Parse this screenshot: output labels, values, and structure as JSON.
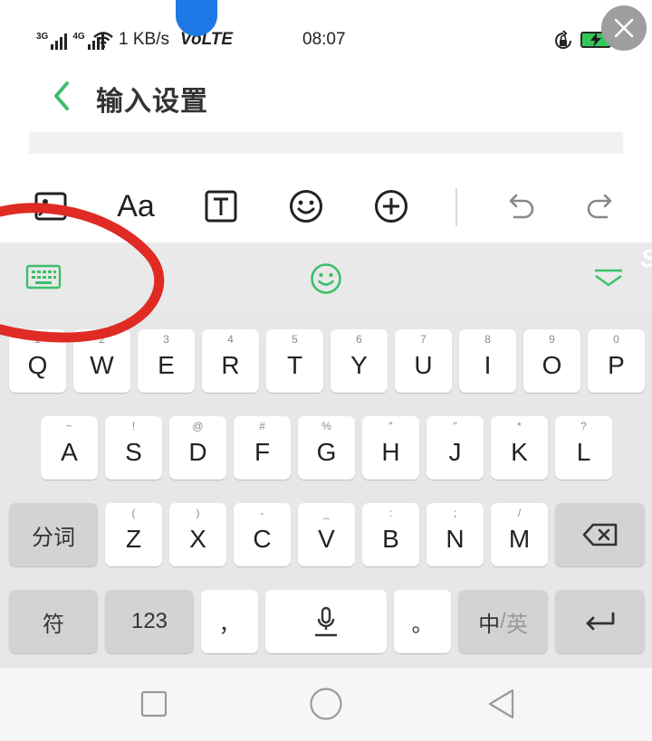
{
  "status_bar": {
    "network_1": "3G",
    "network_2": "4G",
    "speed": "1 KB/s",
    "volte": "VoLTE",
    "time": "08:07"
  },
  "header": {
    "title": "输入设置"
  },
  "colors": {
    "accent": "#3cc06a",
    "annotation_red": "#e02a24",
    "keyboard_bg": "#e7e7e7",
    "func_key_bg": "#d3d3d3"
  },
  "editor_toolbar": {
    "icons": [
      "image-icon",
      "font-size-icon",
      "text-box-icon",
      "emoji-icon",
      "add-icon",
      "undo-icon",
      "redo-icon"
    ],
    "font_label": "Aa",
    "text_box_label": "T"
  },
  "keyboard_topbar": {
    "icons": [
      "keyboard-icon",
      "emoji-smile-icon",
      "collapse-chevron-icon"
    ],
    "watermark": "S"
  },
  "keyboard": {
    "row1": [
      {
        "main": "Q",
        "hint": "1"
      },
      {
        "main": "W",
        "hint": "2"
      },
      {
        "main": "E",
        "hint": "3"
      },
      {
        "main": "R",
        "hint": "4"
      },
      {
        "main": "T",
        "hint": "5"
      },
      {
        "main": "Y",
        "hint": "6"
      },
      {
        "main": "U",
        "hint": "7"
      },
      {
        "main": "I",
        "hint": "8"
      },
      {
        "main": "O",
        "hint": "9"
      },
      {
        "main": "P",
        "hint": "0"
      }
    ],
    "row2": [
      {
        "main": "A",
        "hint": "~"
      },
      {
        "main": "S",
        "hint": "!"
      },
      {
        "main": "D",
        "hint": "@"
      },
      {
        "main": "F",
        "hint": "#"
      },
      {
        "main": "G",
        "hint": "%"
      },
      {
        "main": "H",
        "hint": "\""
      },
      {
        "main": "J",
        "hint": "\""
      },
      {
        "main": "K",
        "hint": "*"
      },
      {
        "main": "L",
        "hint": "?"
      }
    ],
    "row3_left": "分词",
    "row3": [
      {
        "main": "Z",
        "hint": "("
      },
      {
        "main": "X",
        "hint": ")"
      },
      {
        "main": "C",
        "hint": "-"
      },
      {
        "main": "V",
        "hint": "_"
      },
      {
        "main": "B",
        "hint": ":"
      },
      {
        "main": "N",
        "hint": ";"
      },
      {
        "main": "M",
        "hint": "/"
      }
    ],
    "row4": {
      "symbols": "符",
      "numbers": "123",
      "comma": "，",
      "period": "。",
      "lang_zh": "中",
      "lang_sep": "/",
      "lang_en": "英"
    }
  },
  "nav_bar": {
    "icons": [
      "recent-apps-icon",
      "home-icon",
      "back-icon"
    ]
  }
}
